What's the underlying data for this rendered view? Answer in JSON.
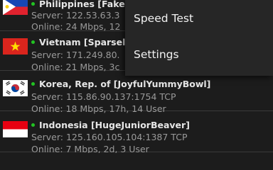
{
  "servers": [
    {
      "name": "Philippines [Fake",
      "server": "Server: 122.53.63.3",
      "online": "Online: 24 Mbps, 12",
      "flag": "philippines",
      "status_color": "#22c322"
    },
    {
      "name": "Vietnam [Sparsel",
      "server": "Server: 171.249.80.",
      "online": "Online: 21 Mbps, 3c",
      "flag": "vietnam",
      "status_color": "#22c322"
    },
    {
      "name": "Korea, Rep. of [JoyfulYummyBowl]",
      "server": "Server: 115.86.90.137:1754 TCP",
      "online": "Online: 18 Mbps, 17h, 14 User",
      "flag": "south-korea",
      "status_color": "#22c322"
    },
    {
      "name": "Indonesia [HugeJuniorBeaver]",
      "server": "Server: 125.160.105.104:1387 TCP",
      "online": "Online: 7 Mbps, 2d, 3 User",
      "flag": "indonesia",
      "status_color": "#22c322"
    }
  ],
  "menu": {
    "items": [
      "Speed Test",
      "Settings"
    ]
  }
}
